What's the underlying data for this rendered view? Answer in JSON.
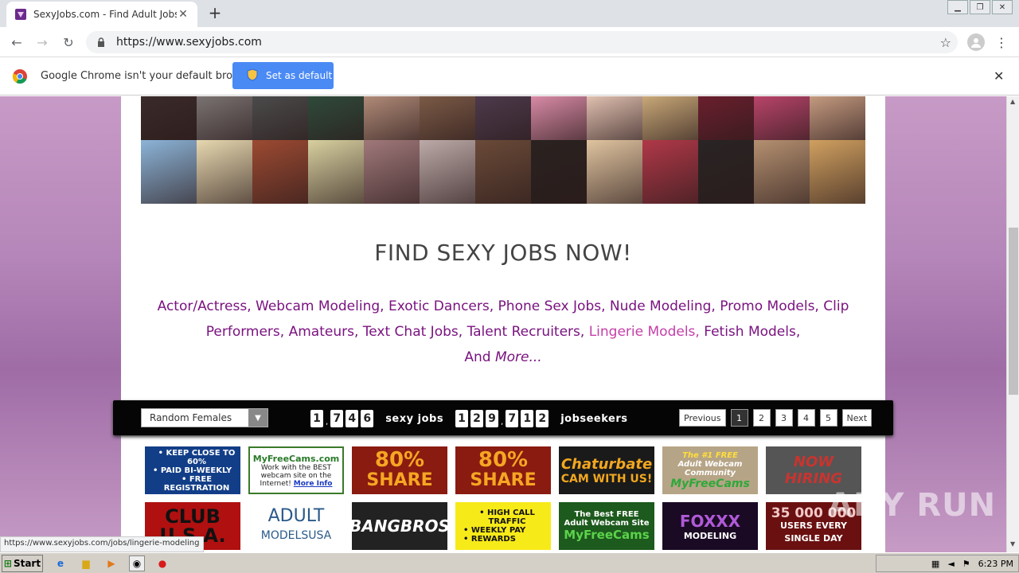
{
  "browser": {
    "tab_title": "SexyJobs.com - Find Adult Jobs, Hir",
    "url": "https://www.sexyjobs.com",
    "infobar_message": "Google Chrome isn't your default browser",
    "infobar_button": "Set as default"
  },
  "gallery": {
    "row1_colors": [
      "#3a2a2a",
      "#7a7272",
      "#4b4b4b",
      "#2f4a3a",
      "#b08a78",
      "#7b5a46",
      "#4d3a4c",
      "#d88aa6",
      "#e0c0b0",
      "#c8a878",
      "#6a1f2e",
      "#b8446a",
      "#c49a80"
    ],
    "row2_colors": [
      "#8cb4d8",
      "#e7d8b0",
      "#9c4a32",
      "#d8d0a0",
      "#a0787a",
      "#bcaaa8",
      "#6a4a38",
      "#2a2220",
      "#e0c4a0",
      "#b03848",
      "#2a2424",
      "#b49070",
      "#d0a060"
    ]
  },
  "headline": "FIND SEXY JOBS NOW!",
  "categories": {
    "items": [
      "Actor/Actress,",
      "Webcam Modeling,",
      "Exotic Dancers,",
      "Phone Sex Jobs,",
      "Nude Modeling,",
      "Promo Models,",
      "Clip Performers,",
      "Amateurs,",
      "Text Chat Jobs,",
      "Talent Recruiters,",
      "Lingerie Models,",
      "Fetish Models,"
    ],
    "and": "And",
    "more": "More..."
  },
  "statbar": {
    "select_value": "Random Females",
    "jobs_digits": [
      "1",
      "7",
      "4",
      "6"
    ],
    "jobs_label": "sexy jobs",
    "seekers_digits": [
      "1",
      "2",
      "9",
      "7",
      "1",
      "2"
    ],
    "seekers_label": "jobseekers",
    "prev": "Previous",
    "pages": [
      "1",
      "2",
      "3",
      "4",
      "5"
    ],
    "next": "Next"
  },
  "ads": {
    "a1": [
      "• KEEP CLOSE TO 60%",
      "• PAID BI-WEEKLY",
      "• FREE REGISTRATION"
    ],
    "a2": [
      "MyFreeCams.com",
      "Work with the BEST",
      "webcam site on the",
      "Internet!",
      "More Info"
    ],
    "a3": [
      "80%",
      "SHARE"
    ],
    "a4": [
      "80%",
      "SHARE"
    ],
    "a5": [
      "Chaturbate",
      "CAM WITH US!"
    ],
    "a6": [
      "The #1 FREE",
      "Adult Webcam",
      "Community",
      "MyFreeCams"
    ],
    "a7": [
      "NOW",
      "HIRING"
    ],
    "b1": [
      "CLUB",
      "U.S.A."
    ],
    "b2": [
      "ADULT",
      "MODELSUSA"
    ],
    "b3": [
      "BANGBROS"
    ],
    "b4": [
      "• HIGH CALL TRAFFIC",
      "• WEEKLY PAY",
      "• REWARDS"
    ],
    "b5": [
      "The Best FREE",
      "Adult Webcam Site",
      "MyFreeCams"
    ],
    "b6": [
      "FOXXX",
      "MODELING"
    ],
    "b7": [
      "35 000 000",
      "USERS EVERY",
      "SINGLE DAY"
    ]
  },
  "status_url": "https://www.sexyjobs.com/jobs/lingerie-modeling",
  "watermark": "ANY RUN",
  "taskbar": {
    "start": "Start",
    "time": "6:23 PM"
  }
}
